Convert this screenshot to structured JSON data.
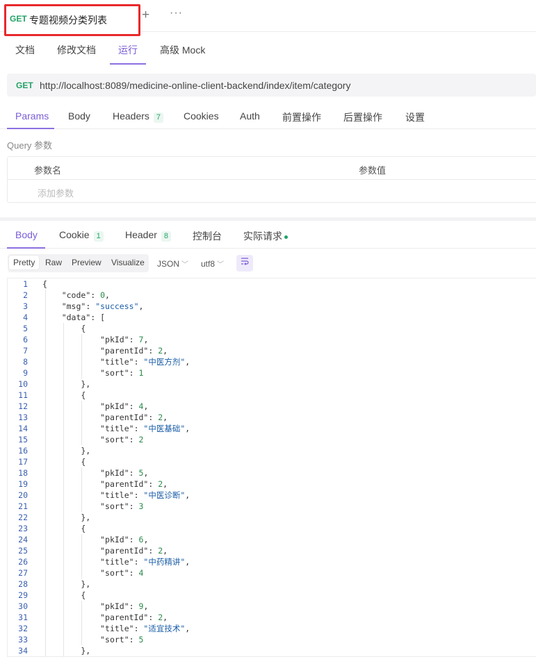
{
  "tab": {
    "method": "GET",
    "name": "专题视频分类列表",
    "plus": "+",
    "more": "···"
  },
  "subnav": {
    "items": [
      "文档",
      "修改文档",
      "运行",
      "高级 Mock"
    ],
    "active": 2
  },
  "request": {
    "method": "GET",
    "url": "http://localhost:8089/medicine-online-client-backend/index/item/category"
  },
  "param_tabs": {
    "items": [
      "Params",
      "Body",
      "Headers",
      "Cookies",
      "Auth",
      "前置操作",
      "后置操作",
      "设置"
    ],
    "headers_count": "7",
    "active": "Params"
  },
  "query": {
    "title": "Query 参数",
    "col_name": "参数名",
    "col_value": "参数值",
    "add_placeholder": "添加参数"
  },
  "response_tabs": {
    "items": [
      "Body",
      "Cookie",
      "Header",
      "控制台",
      "实际请求"
    ],
    "cookie_count": "1",
    "header_count": "8",
    "active": "Body"
  },
  "format": {
    "modes": [
      "Pretty",
      "Raw",
      "Preview",
      "Visualize"
    ],
    "active_mode": "Pretty",
    "type": "JSON",
    "encoding": "utf8",
    "wrap_icon": "wrap-lines-icon"
  },
  "colors": {
    "accent": "#7a5dd6",
    "get": "#21a366",
    "highlight": "#e8292b"
  },
  "code_lines": [
    "{",
    "    \"code\": 0,",
    "    \"msg\": \"success\",",
    "    \"data\": [",
    "        {",
    "            \"pkId\": 7,",
    "            \"parentId\": 2,",
    "            \"title\": \"中医方剂\",",
    "            \"sort\": 1",
    "        },",
    "        {",
    "            \"pkId\": 4,",
    "            \"parentId\": 2,",
    "            \"title\": \"中医基础\",",
    "            \"sort\": 2",
    "        },",
    "        {",
    "            \"pkId\": 5,",
    "            \"parentId\": 2,",
    "            \"title\": \"中医诊断\",",
    "            \"sort\": 3",
    "        },",
    "        {",
    "            \"pkId\": 6,",
    "            \"parentId\": 2,",
    "            \"title\": \"中药精讲\",",
    "            \"sort\": 4",
    "        },",
    "        {",
    "            \"pkId\": 9,",
    "            \"parentId\": 2,",
    "            \"title\": \"适宜技术\",",
    "            \"sort\": 5",
    "        },"
  ]
}
